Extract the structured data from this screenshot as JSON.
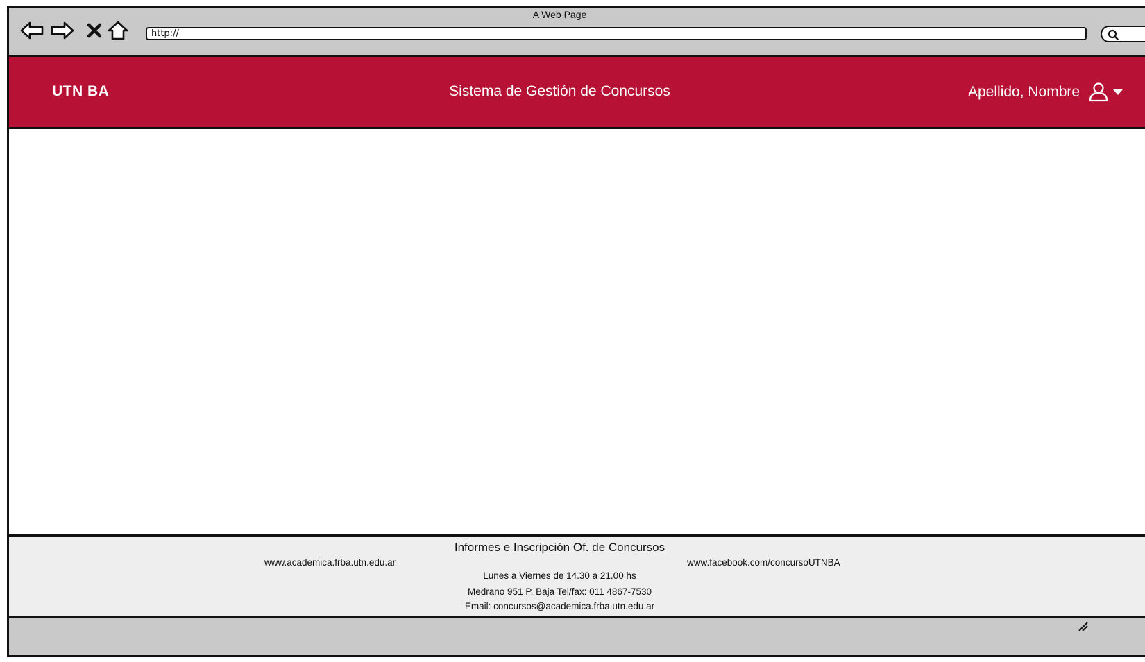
{
  "window": {
    "title": "A Web Page"
  },
  "browser": {
    "url": "http://",
    "buttons": [
      "back",
      "forward",
      "stop",
      "home"
    ]
  },
  "header": {
    "brand": "UTN BA",
    "title": "Sistema de Gestión de Concursos",
    "user_name": "Apellido, Nombre",
    "bg_color": "#b71235"
  },
  "footer": {
    "title": "Informes e Inscripción Of. de Concursos",
    "link_left": "www.academica.frba.utn.edu.ar",
    "link_right": "www.facebook.com/concursoUTNBA",
    "hours": "Lunes a Viernes de 14.30 a 21.00 hs",
    "address": "Medrano 951 P. Baja Tel/fax: 011 4867-7530",
    "email": "Email: concursos@academica.frba.utn.edu.ar"
  }
}
